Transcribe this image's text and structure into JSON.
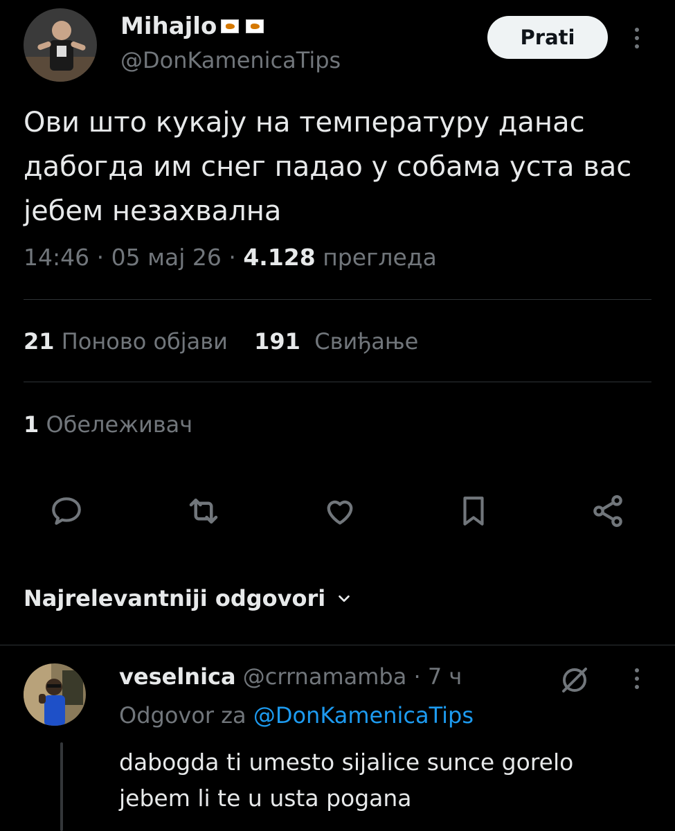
{
  "tweet": {
    "author_name": "Mihajlo",
    "author_handle": "@DonKamenicaTips",
    "follow_label": "Prati",
    "text": "Ови што кукају на температуру данас дабогда им снег падао у собама уста вас јебем незахвална",
    "time": "14:46",
    "date": "05 мај 26",
    "views_count": "4.128",
    "views_label": "прегледа",
    "reposts_count": "21",
    "reposts_label": "Поново објави",
    "likes_count": "191",
    "likes_label": "Свиђање",
    "bookmarks_count": "1",
    "bookmarks_label": "Обележивач"
  },
  "actions": [
    {
      "name": "reply-icon"
    },
    {
      "name": "repost-icon"
    },
    {
      "name": "like-icon"
    },
    {
      "name": "bookmark-icon"
    },
    {
      "name": "share-icon"
    }
  ],
  "replies_sort": {
    "label": "Najrelevantniji odgovori"
  },
  "reply": {
    "author_name": "veselnica",
    "author_handle": "@crrnamamba",
    "time": "7 ч",
    "reply_to_label": "Odgovor za",
    "reply_to_handle": "@DonKamenicaTips",
    "text": "dabogda ti umesto sijalice sunce gorelo jebem li te u usta pogana"
  },
  "colors": {
    "background": "#000000",
    "text_primary": "#e7e9ea",
    "text_secondary": "#71767b",
    "accent": "#1d9bf0",
    "divider": "#2f3336"
  }
}
